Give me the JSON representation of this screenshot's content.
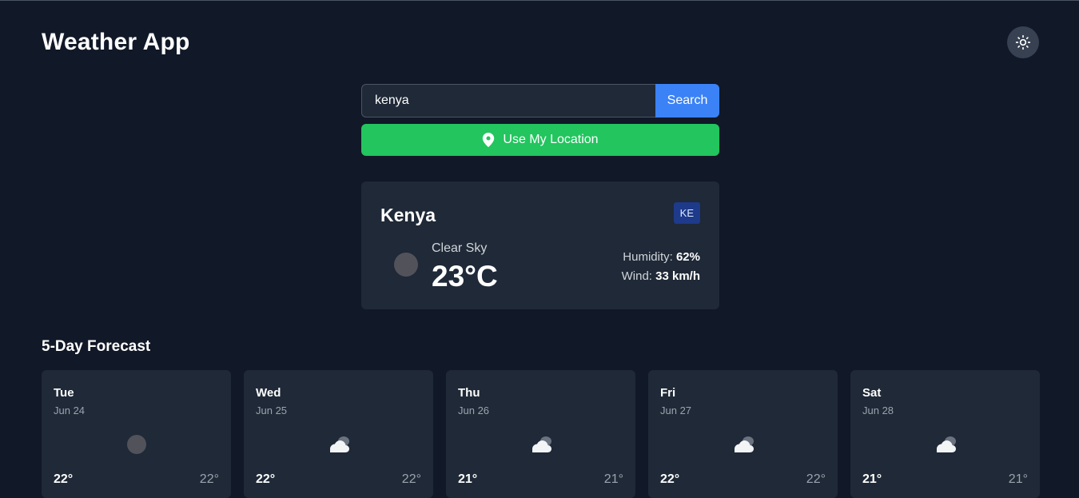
{
  "header": {
    "title": "Weather App",
    "theme_icon": "sun-icon"
  },
  "search": {
    "value": "kenya",
    "placeholder": "",
    "button_label": "Search"
  },
  "location": {
    "label": "Use My Location",
    "icon": "map-pin-icon"
  },
  "current": {
    "city": "Kenya",
    "country_code": "KE",
    "condition": "Clear Sky",
    "temperature": "23°C",
    "humidity_label": "Humidity:",
    "humidity_value": "62%",
    "wind_label": "Wind:",
    "wind_value": "33 km/h",
    "icon": "clear-night-icon"
  },
  "forecast": {
    "heading": "5-Day Forecast",
    "days": [
      {
        "day": "Tue",
        "date": "Jun 24",
        "high": "22°",
        "low": "22°",
        "icon": "clear-night-icon"
      },
      {
        "day": "Wed",
        "date": "Jun 25",
        "high": "22°",
        "low": "22°",
        "icon": "cloud-icon"
      },
      {
        "day": "Thu",
        "date": "Jun 26",
        "high": "21°",
        "low": "21°",
        "icon": "cloud-icon"
      },
      {
        "day": "Fri",
        "date": "Jun 27",
        "high": "22°",
        "low": "22°",
        "icon": "cloud-icon"
      },
      {
        "day": "Sat",
        "date": "Jun 28",
        "high": "21°",
        "low": "21°",
        "icon": "cloud-icon"
      }
    ]
  },
  "colors": {
    "background": "#111827",
    "card": "#1f2937",
    "accent_blue": "#3b82f6",
    "accent_green": "#22c55e",
    "badge": "#1e3a8a"
  }
}
